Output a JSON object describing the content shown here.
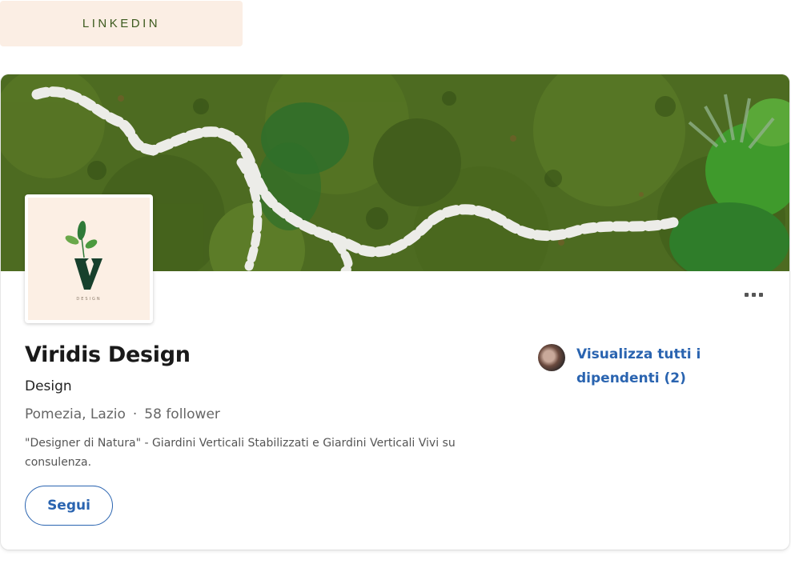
{
  "header_chip": {
    "label": "LINKEDIN"
  },
  "company": {
    "name": "Viridis Design",
    "industry": "Design",
    "location": "Pomezia, Lazio",
    "separator": "·",
    "followers": "58 follower",
    "tagline": "\"Designer di Natura\" - Giardini Verticali Stabilizzati e Giardini Verticali Vivi su consulenza.",
    "logo": {
      "icon": "viridis-design-logo",
      "letter": "V",
      "subtext": "DESIGN"
    }
  },
  "actions": {
    "follow_label": "Segui",
    "more_icon": "more-horizontal-icon"
  },
  "employees": {
    "link_text": "Visualizza tutti i dipendenti (2)"
  },
  "colors": {
    "accent_blue": "#2a64b0",
    "chip_bg": "#fbeee4",
    "chip_text": "#3c5a1e",
    "moss_green": "#4a6a22",
    "logo_green": "#17402c"
  }
}
